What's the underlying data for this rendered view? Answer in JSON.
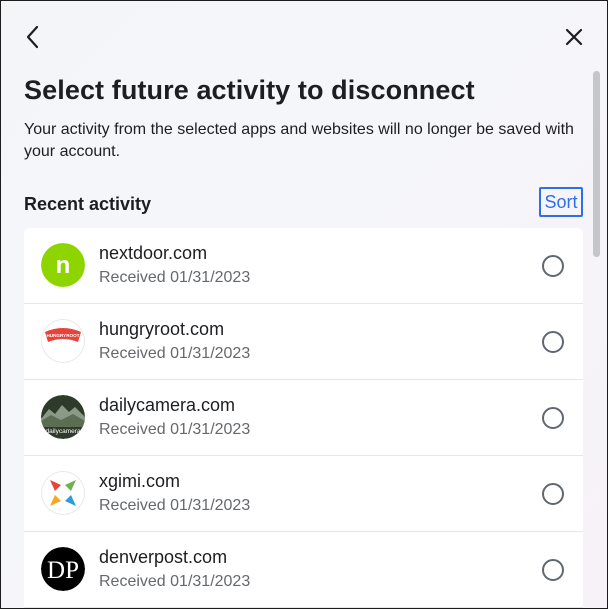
{
  "header": {
    "title": "Select future activity to disconnect",
    "subtitle": "Your activity from the selected apps and websites will no longer be saved with your account.",
    "section_label": "Recent activity",
    "sort_label": "Sort"
  },
  "activity": [
    {
      "site": "nextdoor.com",
      "received": "Received 01/31/2023",
      "icon": "nextdoor-logo-icon",
      "selected": false
    },
    {
      "site": "hungryroot.com",
      "received": "Received 01/31/2023",
      "icon": "hungryroot-logo-icon",
      "selected": false
    },
    {
      "site": "dailycamera.com",
      "received": "Received 01/31/2023",
      "icon": "dailycamera-logo-icon",
      "selected": false
    },
    {
      "site": "xgimi.com",
      "received": "Received 01/31/2023",
      "icon": "xgimi-logo-icon",
      "selected": false
    },
    {
      "site": "denverpost.com",
      "received": "Received 01/31/2023",
      "icon": "denverpost-logo-icon",
      "selected": false
    }
  ],
  "logos": {
    "nextdoor_mark": "n",
    "hungryroot_mark": "HUNGRYROOT",
    "dailycamera_mark": "dailycamera",
    "denverpost_mark": "DP"
  },
  "colors": {
    "accent": "#2d6fe8",
    "text_primary": "#1c1e21",
    "text_secondary": "#65686c",
    "nextdoor_green": "#8ed500",
    "hungryroot_red": "#e8423a"
  }
}
